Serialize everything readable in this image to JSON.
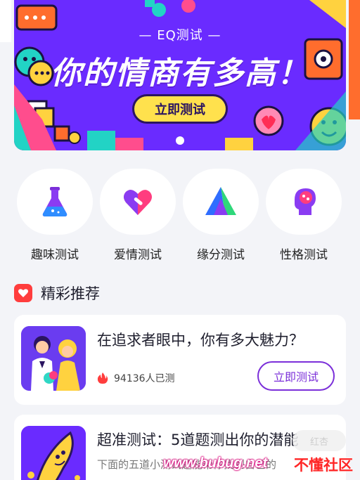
{
  "banner": {
    "subtitle": "— EQ测试 —",
    "title": "你的情商有多高！",
    "button_label": "立即测试",
    "bg_color": "#6a2bff",
    "button_color": "#ffe14d"
  },
  "categories": [
    {
      "label": "趣味测试",
      "icon": "flask-icon"
    },
    {
      "label": "爱情测试",
      "icon": "heart-icon"
    },
    {
      "label": "缘分测试",
      "icon": "triangle-icon"
    },
    {
      "label": "性格测试",
      "icon": "head-brain-icon"
    }
  ],
  "section": {
    "title": "精彩推荐",
    "accent": "#ff3d3d"
  },
  "cards": [
    {
      "title": "在追求者眼中，你有多大魅力？",
      "stat": "94136人已测",
      "button_label": "立即测试",
      "thumb": "couple-illustration"
    },
    {
      "title": "超准测试：5道题测出你的潜能",
      "desc": "下面的五道小测试题能帮你找到自己的",
      "thumb": "banana-illustration"
    }
  ],
  "watermark": {
    "faint": "红杏",
    "url": "www.bubug.net",
    "brand": "不懂社区"
  },
  "accent_color": "#7b2fd9"
}
